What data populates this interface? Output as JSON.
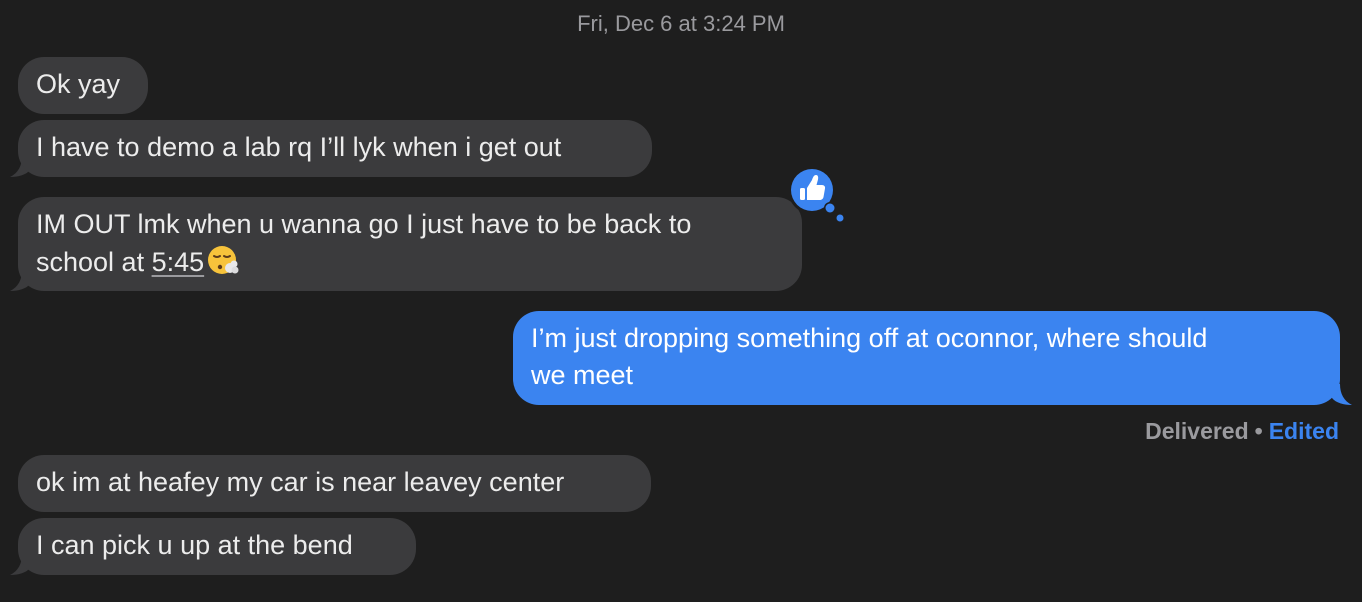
{
  "conversation": {
    "timestamp": "Fri, Dec 6 at 3:24 PM",
    "messages": [
      {
        "id": "m1",
        "direction": "incoming",
        "text": "Ok yay"
      },
      {
        "id": "m2",
        "direction": "incoming",
        "text": "I have to demo a lab rq I’ll lyk when i get out"
      },
      {
        "id": "m3",
        "direction": "incoming",
        "line1": "IM OUT lmk when u wanna go I just have to be back to",
        "line2_prefix": "school at ",
        "line2_time": "5:45",
        "emoji": "face-exhaling-emoji",
        "reaction": "thumbs-up"
      },
      {
        "id": "m4",
        "direction": "outgoing",
        "line1": "I’m just dropping something off at oconnor, where should",
        "line2": "we meet"
      },
      {
        "id": "m5",
        "direction": "incoming",
        "text": "ok im at heafey my car is near leavey center"
      },
      {
        "id": "m6",
        "direction": "incoming",
        "text": "I can pick u up at the bend"
      }
    ],
    "status": {
      "delivered": "Delivered",
      "separator": "•",
      "edited": "Edited"
    }
  },
  "colors": {
    "background": "#1e1e1e",
    "incoming_bubble": "#3b3b3d",
    "outgoing_bubble": "#3b84f0",
    "muted_text": "#9a9a9e"
  }
}
